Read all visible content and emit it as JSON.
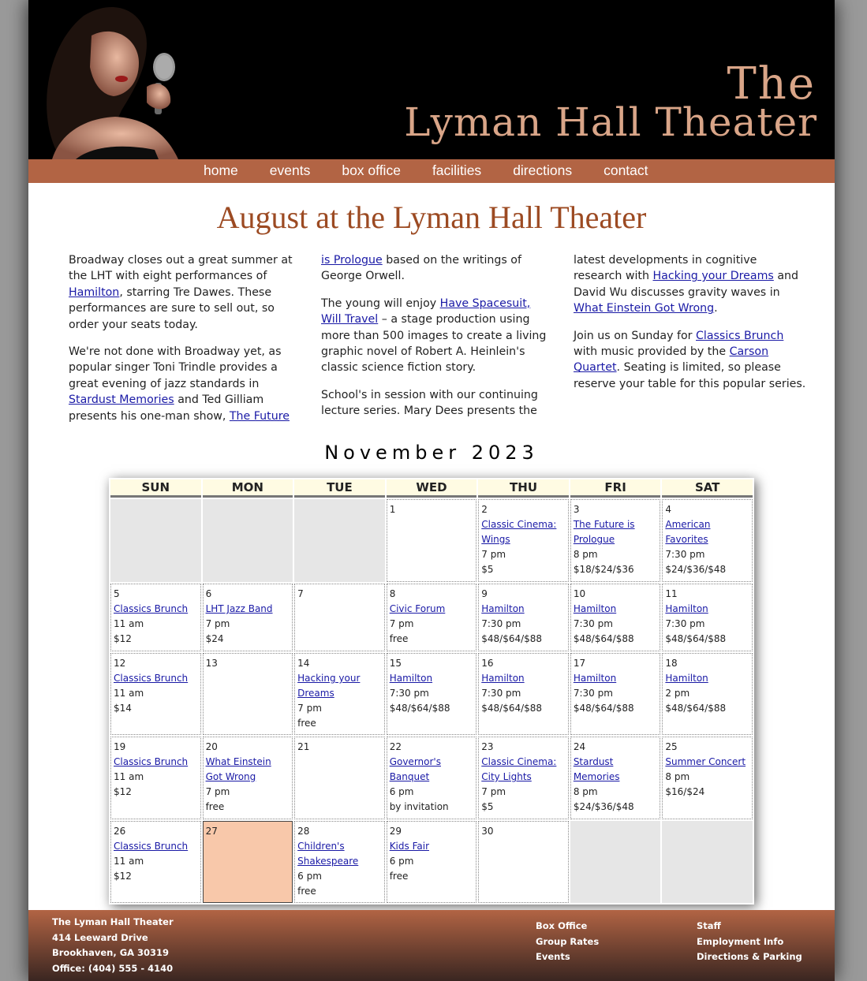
{
  "header": {
    "title_the": "The",
    "title_main": "Lyman Hall Theater"
  },
  "nav": [
    "home",
    "events",
    "box office",
    "facilities",
    "directions",
    "contact"
  ],
  "heading": "August at the Lyman Hall Theater",
  "article": {
    "p1": {
      "t1": "Broadway closes out a great summer at the LHT with eight performances of ",
      "l1": "Hamilton",
      "t2": ", starring Tre Dawes. These performances are sure to sell out, so order your seats today."
    },
    "p2": {
      "t1": "We're not done with Broadway yet, as popular singer Toni Trindle provides a great evening of jazz standards in ",
      "l1": "Stardust Memories",
      "t2": " and Ted Gilliam presents his one-man show, ",
      "l2": "The Future is Prologue",
      "t3": " based on the writings of George Orwell."
    },
    "p3": {
      "t1": "The young will enjoy ",
      "l1": "Have Spacesuit, Will Travel",
      "t2": " – a stage production using more than 500 images to create a living graphic novel of Robert A. Heinlein's classic science fiction story."
    },
    "p4": {
      "t1": "School's in session with our continuing lecture series. Mary Dees presents the latest developments in cognitive research with ",
      "l1": "Hacking your Dreams",
      "t2": " and David Wu discusses gravity waves in ",
      "l2": "What Einstein Got Wrong",
      "t3": "."
    },
    "p5": {
      "t1": "Join us on Sunday for ",
      "l1": "Classics Brunch",
      "t2": " with music provided by the ",
      "l2": "Carson Quartet",
      "t3": ". Seating is limited, so please reserve your table for this popular series."
    }
  },
  "calendar": {
    "caption": "November 2023",
    "days": [
      "SUN",
      "MON",
      "TUE",
      "WED",
      "THU",
      "FRI",
      "SAT"
    ],
    "weeks": [
      [
        {
          "empty": true
        },
        {
          "empty": true
        },
        {
          "empty": true
        },
        {
          "day": "1"
        },
        {
          "day": "2",
          "event": "Classic Cinema: Wings",
          "time": "7 pm",
          "price": "$5"
        },
        {
          "day": "3",
          "event": "The Future is Prologue",
          "time": "8 pm",
          "price": "$18/$24/$36"
        },
        {
          "day": "4",
          "event": "American Favorites",
          "time": "7:30 pm",
          "price": "$24/$36/$48"
        }
      ],
      [
        {
          "day": "5",
          "event": "Classics Brunch",
          "time": "11 am",
          "price": "$12"
        },
        {
          "day": "6",
          "event": "LHT Jazz Band",
          "time": "7 pm",
          "price": "$24"
        },
        {
          "day": "7"
        },
        {
          "day": "8",
          "event": "Civic Forum",
          "time": "7 pm",
          "price": "free"
        },
        {
          "day": "9",
          "event": "Hamilton",
          "time": "7:30 pm",
          "price": "$48/$64/$88"
        },
        {
          "day": "10",
          "event": "Hamilton",
          "time": "7:30 pm",
          "price": "$48/$64/$88"
        },
        {
          "day": "11",
          "event": "Hamilton",
          "time": "7:30 pm",
          "price": "$48/$64/$88"
        }
      ],
      [
        {
          "day": "12",
          "event": "Classics Brunch",
          "time": "11 am",
          "price": "$14"
        },
        {
          "day": "13"
        },
        {
          "day": "14",
          "event": "Hacking your Dreams",
          "time": "7 pm",
          "price": "free"
        },
        {
          "day": "15",
          "event": "Hamilton",
          "time": "7:30 pm",
          "price": "$48/$64/$88"
        },
        {
          "day": "16",
          "event": "Hamilton",
          "time": "7:30 pm",
          "price": "$48/$64/$88"
        },
        {
          "day": "17",
          "event": "Hamilton",
          "time": "7:30 pm",
          "price": "$48/$64/$88"
        },
        {
          "day": "18",
          "event": "Hamilton",
          "time": "2 pm",
          "price": "$48/$64/$88"
        }
      ],
      [
        {
          "day": "19",
          "event": "Classics Brunch",
          "time": "11 am",
          "price": "$12"
        },
        {
          "day": "20",
          "event": "What Einstein Got Wrong",
          "time": "7 pm",
          "price": "free"
        },
        {
          "day": "21"
        },
        {
          "day": "22",
          "event": "Governor's Banquet",
          "time": "6 pm",
          "price": "by invitation"
        },
        {
          "day": "23",
          "event": "Classic Cinema: City Lights",
          "time": "7 pm",
          "price": "$5"
        },
        {
          "day": "24",
          "event": "Stardust Memories",
          "time": "8 pm",
          "price": "$24/$36/$48"
        },
        {
          "day": "25",
          "event": "Summer Concert",
          "time": "8 pm",
          "price": "$16/$24"
        }
      ],
      [
        {
          "day": "26",
          "event": "Classics Brunch",
          "time": "11 am",
          "price": "$12"
        },
        {
          "day": "27",
          "today": true
        },
        {
          "day": "28",
          "event": "Children's Shakespeare",
          "time": "6 pm",
          "price": "free"
        },
        {
          "day": "29",
          "event": "Kids Fair",
          "time": "6 pm",
          "price": "free"
        },
        {
          "day": "30"
        },
        {
          "empty": true
        },
        {
          "empty": true
        }
      ]
    ]
  },
  "footer": {
    "address": [
      "The Lyman Hall Theater",
      "414 Leeward Drive",
      "Brookhaven, GA 30319",
      "Office: (404) 555 - 4140"
    ],
    "links1": [
      "Box Office",
      "Group Rates",
      "Events"
    ],
    "links2": [
      "Staff",
      "Employment Info",
      "Directions & Parking"
    ]
  },
  "colors": {
    "nav_bg": "#b26444",
    "heading": "#9c4a22",
    "title": "#d9a588",
    "today_cell": "#f8c8aa",
    "link": "#1a1aa6"
  }
}
